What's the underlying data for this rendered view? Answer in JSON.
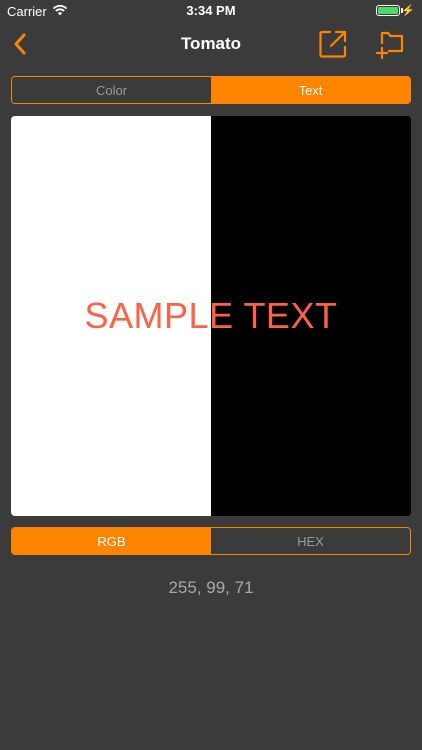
{
  "status_bar": {
    "carrier": "Carrier",
    "time": "3:34 PM"
  },
  "nav": {
    "title": "Tomato"
  },
  "top_segment": {
    "options": [
      "Color",
      "Text"
    ],
    "selected": "Text"
  },
  "preview": {
    "sample_text": "SAMPLE TEXT",
    "text_color": "#ff6347",
    "left_background": "#ffffff",
    "right_background": "#000000"
  },
  "bottom_segment": {
    "options": [
      "RGB",
      "HEX"
    ],
    "selected": "RGB"
  },
  "value_text": "255, 99, 71",
  "colors": {
    "accent": "#ff8400",
    "background": "#3b3b3b"
  }
}
